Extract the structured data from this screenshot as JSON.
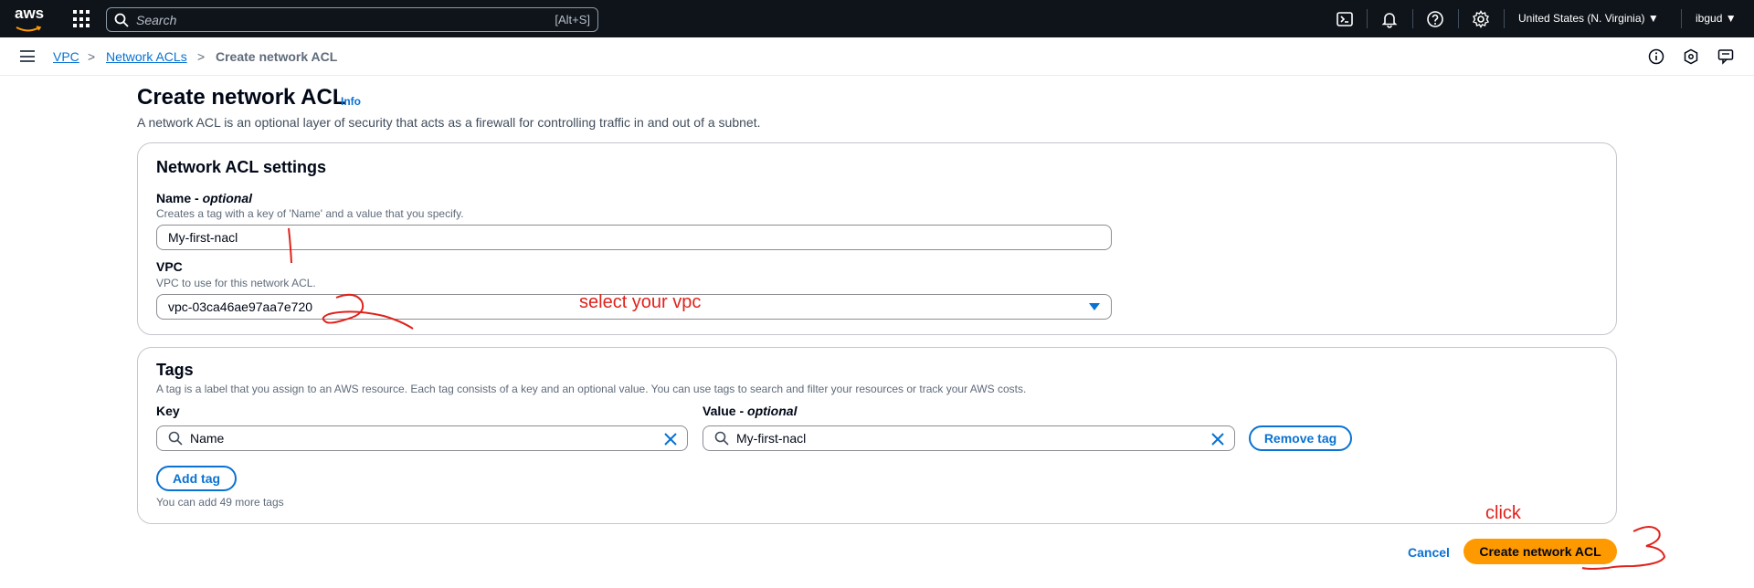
{
  "topnav": {
    "logo_text": "aws",
    "search_placeholder": "Search",
    "search_shortcut": "[Alt+S]",
    "region": "United States (N. Virginia) ▼",
    "user": "ibgud ▼",
    "icons": [
      "grid-icon",
      "cloudshell-icon",
      "bell-icon",
      "help-icon",
      "gear-icon"
    ]
  },
  "breadcrumb": {
    "items": [
      "VPC",
      "Network ACLs"
    ],
    "current": "Create network ACL",
    "separator": ">"
  },
  "header": {
    "title": "Create network ACL",
    "info": "Info",
    "description": "A network ACL is an optional layer of security that acts as a firewall for controlling traffic in and out of a subnet."
  },
  "settings": {
    "heading": "Network ACL settings",
    "name_label": "Name - ",
    "name_label_optional": "optional",
    "name_description": "Creates a tag with a key of 'Name' and a value that you specify.",
    "name_value": "My-first-nacl",
    "vpc_label": "VPC",
    "vpc_description": "VPC to use for this network ACL.",
    "vpc_value": "vpc-03ca46ae97aa7e720"
  },
  "tags": {
    "heading": "Tags",
    "description": "A tag is a label that you assign to an AWS resource. Each tag consists of a key and an optional value. You can use tags to search and filter your resources or track your AWS costs.",
    "key_label": "Key",
    "value_label": "Value - ",
    "value_label_optional": "optional",
    "key_value": "Name",
    "value_value": "My-first-nacl",
    "remove_label": "Remove tag",
    "add_label": "Add tag",
    "limit_note": "You can add 49 more tags"
  },
  "footer": {
    "cancel_label": "Cancel",
    "create_label": "Create network ACL"
  },
  "annotations": {
    "select_note": "select your vpc",
    "click_note": "click",
    "color": "#e0221b"
  }
}
